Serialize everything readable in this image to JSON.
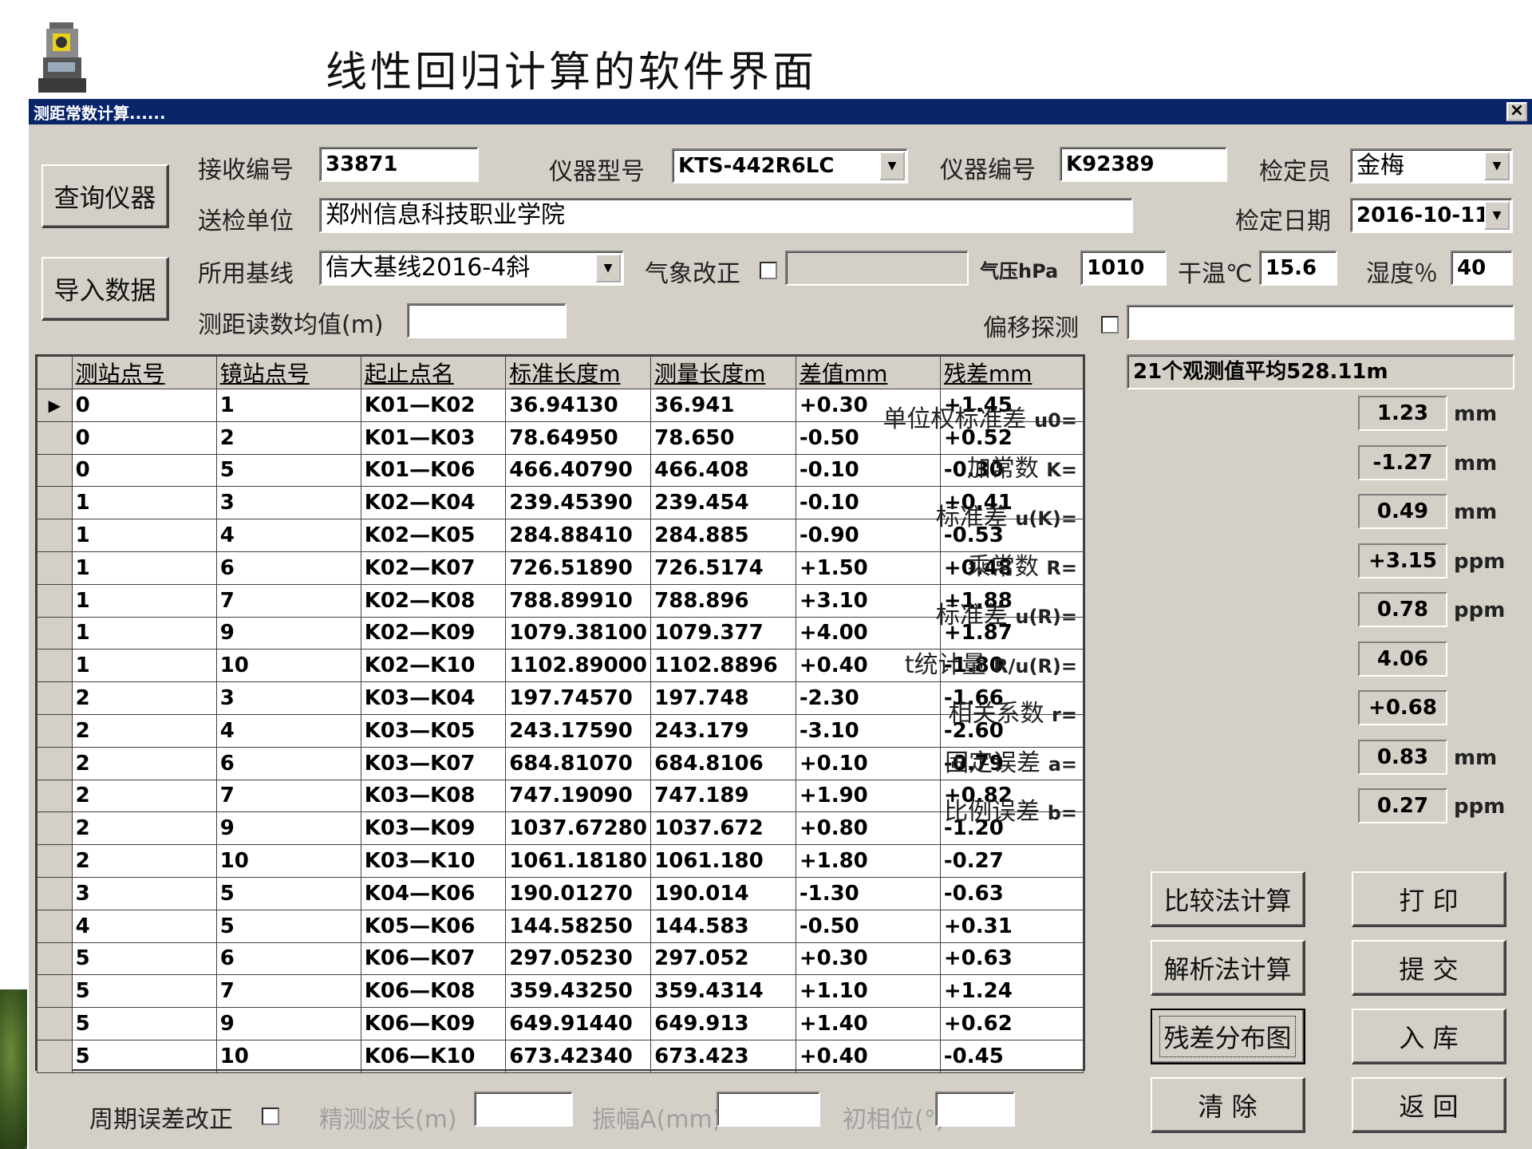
{
  "slide": {
    "title": "线性回归计算的软件界面"
  },
  "window": {
    "title": "测距常数计算......"
  },
  "buttons": {
    "query": "查询仪器",
    "import": "导入数据",
    "compare": "比较法计算",
    "print": "打 印",
    "analytic": "解析法计算",
    "submit": "提 交",
    "residual": "残差分布图",
    "store": "入 库",
    "clear": "清 除",
    "back": "返 回"
  },
  "form": {
    "receive_no_label": "接收编号",
    "receive_no": "33871",
    "model_label": "仪器型号",
    "model": "KTS-442R6LC",
    "serial_label": "仪器编号",
    "serial": "K92389",
    "inspector_label": "检定员",
    "inspector": "金梅",
    "unit_label": "送检单位",
    "unit": "郑州信息科技职业学院",
    "date_label": "检定日期",
    "date": "2016-10-11",
    "baseline_label": "所用基线",
    "baseline": "信大基线2016-4斜",
    "meteo_label": "气象改正",
    "pressure_label": "气压hPa",
    "pressure": "1010",
    "temp_label": "干温℃",
    "temp": "15.6",
    "humidity_label": "湿度％",
    "humidity": "40",
    "mean_label": "测距读数均值(m)",
    "offset_label": "偏移探测"
  },
  "table": {
    "headers": [
      "测站点号",
      "镜站点号",
      "起止点名",
      "标准长度m",
      "测量长度m",
      "差值mm",
      "残差mm"
    ],
    "rows": [
      [
        "0",
        "1",
        "K01—K02",
        "36.94130",
        "36.941",
        "+0.30",
        "+1.45"
      ],
      [
        "0",
        "2",
        "K01—K03",
        "78.64950",
        "78.650",
        "-0.50",
        "+0.52"
      ],
      [
        "0",
        "5",
        "K01—K06",
        "466.40790",
        "466.408",
        "-0.10",
        "-0.30"
      ],
      [
        "1",
        "3",
        "K02—K04",
        "239.45390",
        "239.454",
        "-0.10",
        "+0.41"
      ],
      [
        "1",
        "4",
        "K02—K05",
        "284.88410",
        "284.885",
        "-0.90",
        "-0.53"
      ],
      [
        "1",
        "6",
        "K02—K07",
        "726.51890",
        "726.5174",
        "+1.50",
        "+0.48"
      ],
      [
        "1",
        "7",
        "K02—K08",
        "788.89910",
        "788.896",
        "+3.10",
        "+1.88"
      ],
      [
        "1",
        "9",
        "K02—K09",
        "1079.38100",
        "1079.377",
        "+4.00",
        "+1.87"
      ],
      [
        "1",
        "10",
        "K02—K10",
        "1102.89000",
        "1102.8896",
        "+0.40",
        "-1.80"
      ],
      [
        "2",
        "3",
        "K03—K04",
        "197.74570",
        "197.748",
        "-2.30",
        "-1.66"
      ],
      [
        "2",
        "4",
        "K03—K05",
        "243.17590",
        "243.179",
        "-3.10",
        "-2.60"
      ],
      [
        "2",
        "6",
        "K03—K07",
        "684.81070",
        "684.8106",
        "+0.10",
        "-0.79"
      ],
      [
        "2",
        "7",
        "K03—K08",
        "747.19090",
        "747.189",
        "+1.90",
        "+0.82"
      ],
      [
        "2",
        "9",
        "K03—K09",
        "1037.67280",
        "1037.672",
        "+0.80",
        "-1.20"
      ],
      [
        "2",
        "10",
        "K03—K10",
        "1061.18180",
        "1061.180",
        "+1.80",
        "-0.27"
      ],
      [
        "3",
        "5",
        "K04—K06",
        "190.01270",
        "190.014",
        "-1.30",
        "-0.63"
      ],
      [
        "4",
        "5",
        "K05—K06",
        "144.58250",
        "144.583",
        "-0.50",
        "+0.31"
      ],
      [
        "5",
        "6",
        "K06—K07",
        "297.05230",
        "297.052",
        "+0.30",
        "+0.63"
      ],
      [
        "5",
        "7",
        "K06—K08",
        "359.43250",
        "359.4314",
        "+1.10",
        "+1.24"
      ],
      [
        "5",
        "9",
        "K06—K09",
        "649.91440",
        "649.913",
        "+1.40",
        "+0.62"
      ],
      [
        "5",
        "10",
        "K06—K10",
        "673.42340",
        "673.423",
        "+0.40",
        "-0.45"
      ]
    ]
  },
  "results": {
    "summary": "21个观测值平均528.11m",
    "items": [
      {
        "label": "单位权标准差",
        "sym": "u0=",
        "value": "1.23",
        "unit": "mm"
      },
      {
        "label": "加常数",
        "sym": "K=",
        "value": "-1.27",
        "unit": "mm"
      },
      {
        "label": "标准差",
        "sym": "u(K)=",
        "value": "0.49",
        "unit": "mm"
      },
      {
        "label": "乘常数",
        "sym": "R=",
        "value": "+3.15",
        "unit": "ppm"
      },
      {
        "label": "标准差",
        "sym": "u(R)=",
        "value": "0.78",
        "unit": "ppm"
      },
      {
        "label": "t统计量",
        "sym": "R/u(R)=",
        "value": "4.06",
        "unit": ""
      },
      {
        "label": "相关系数",
        "sym": "r=",
        "value": "+0.68",
        "unit": ""
      },
      {
        "label": "固定误差",
        "sym": "a=",
        "value": "0.83",
        "unit": "mm"
      },
      {
        "label": "比例误差",
        "sym": "b=",
        "value": "0.27",
        "unit": "ppm"
      }
    ]
  },
  "cycle": {
    "label": "周期误差改正",
    "wavelength_label": "精测波长(m)",
    "amplitude_label": "振幅A(mm)",
    "phase_label": "初相位(°)"
  }
}
